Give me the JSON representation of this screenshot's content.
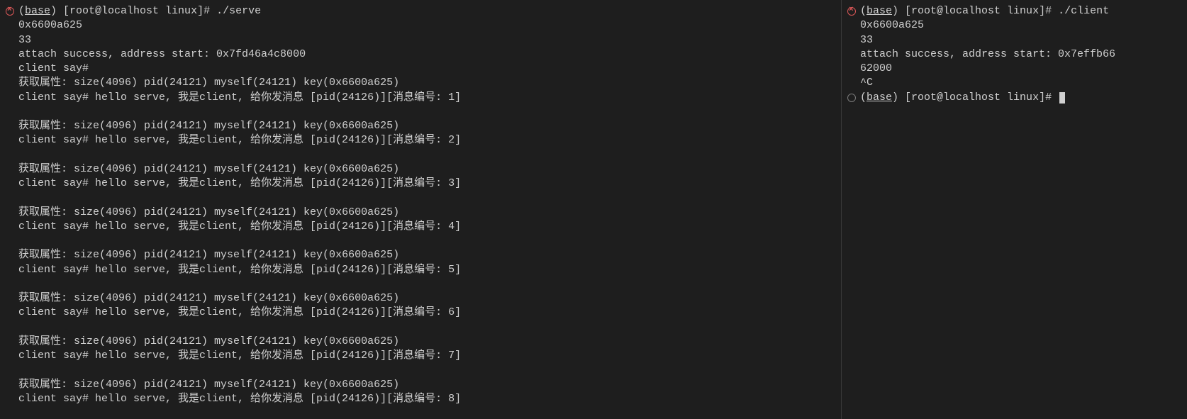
{
  "left": {
    "prompt": {
      "base": "base",
      "rest": ") [root@localhost linux]# ./serve"
    },
    "out1": "0x6600a625",
    "out2": "33",
    "out3": "attach success, address start: 0x7fd46a4c8000",
    "out4": "client say#",
    "attr": "获取属性: size(4096) pid(24121) myself(24121) key(0x6600a625)",
    "msg1": "client say# hello serve, 我是client, 给你发消息 [pid(24126)][消息编号: 1]",
    "msg2": "client say# hello serve, 我是client, 给你发消息 [pid(24126)][消息编号: 2]",
    "msg3": "client say# hello serve, 我是client, 给你发消息 [pid(24126)][消息编号: 3]",
    "msg4": "client say# hello serve, 我是client, 给你发消息 [pid(24126)][消息编号: 4]",
    "msg5": "client say# hello serve, 我是client, 给你发消息 [pid(24126)][消息编号: 5]",
    "msg6": "client say# hello serve, 我是client, 给你发消息 [pid(24126)][消息编号: 6]",
    "msg7": "client say# hello serve, 我是client, 给你发消息 [pid(24126)][消息编号: 7]",
    "msg8": "client say# hello serve, 我是client, 给你发消息 [pid(24126)][消息编号: 8]"
  },
  "right": {
    "prompt1": {
      "base": "base",
      "rest": ") [root@localhost linux]# ./client"
    },
    "out1": "0x6600a625",
    "out2": "33",
    "out3a": "attach success, address start: 0x7effb66",
    "out3b": "62000",
    "out4": "^C",
    "prompt2": {
      "base": "base",
      "rest": ") [root@localhost linux]# "
    }
  }
}
